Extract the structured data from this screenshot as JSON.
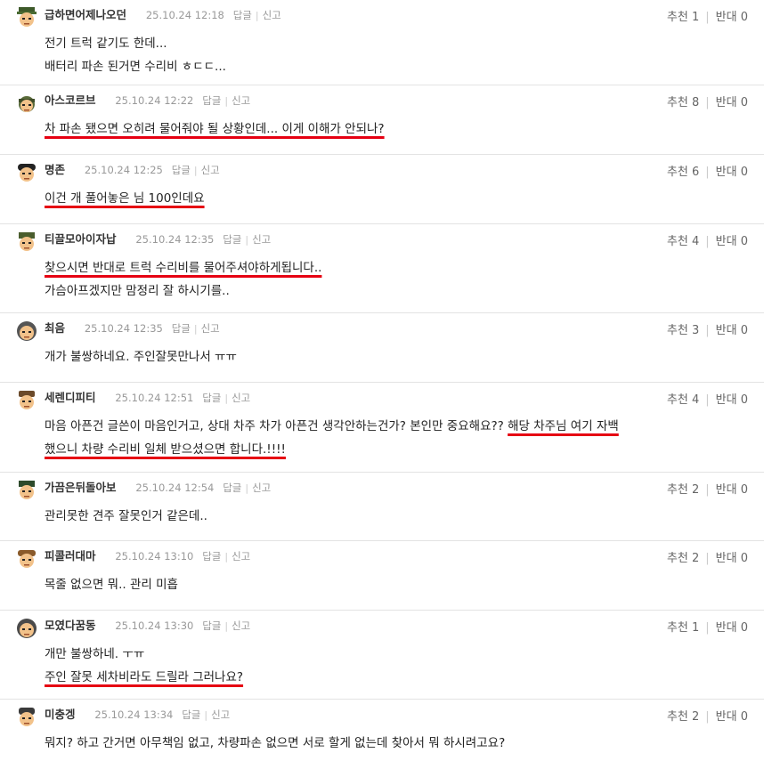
{
  "labels": {
    "reply": "답글",
    "report": "신고"
  },
  "comments": [
    {
      "nick": "급하면어제나오던",
      "date": "25.10.24 12:18",
      "up": "추천 1",
      "down": "반대 0",
      "line1": "전기 트럭 같기도 한데...",
      "line2": "배터리 파손 된거면 수리비 ㅎㄷㄷ..."
    },
    {
      "nick": "아스코르브",
      "date": "25.10.24 12:22",
      "up": "추천 8",
      "down": "반대 0",
      "line1": "차 파손 됐으면 오히려 물어줘야 될 상황인데... 이게 이해가 안되나?"
    },
    {
      "nick": "명존",
      "date": "25.10.24 12:25",
      "up": "추천 6",
      "down": "반대 0",
      "line1": "이건 개 풀어놓은 님 100인데요"
    },
    {
      "nick": "티끌모아이자납",
      "date": "25.10.24 12:35",
      "up": "추천 4",
      "down": "반대 0",
      "line1": "찾으시면 반대로 트럭 수리비를 물어주셔야하게됩니다..",
      "line2": "가슴아프겠지만 맘정리 잘 하시기를.."
    },
    {
      "nick": "최음",
      "date": "25.10.24 12:35",
      "up": "추천 3",
      "down": "반대 0",
      "line1": "개가 불쌍하네요. 주인잘못만나서 ㅠㅠ"
    },
    {
      "nick": "세렌디피티",
      "date": "25.10.24 12:51",
      "up": "추천 4",
      "down": "반대 0",
      "line1a": "마음 아픈건 글쓴이 마음인거고, 상대 차주 차가 아픈건 생각안하는건가? 본인만 중요해요?? ",
      "line1b": "해당 차주님 여기 자백",
      "line2": "했으니 차량 수리비 일체 받으셨으면 합니다.!!!!"
    },
    {
      "nick": "가끔은뒤돌아보",
      "date": "25.10.24 12:54",
      "up": "추천 2",
      "down": "반대 0",
      "line1": "관리못한 견주 잘못인거 같은데.."
    },
    {
      "nick": "피콜러대마",
      "date": "25.10.24 13:10",
      "up": "추천 2",
      "down": "반대 0",
      "line1": "목줄 없으면 뭐.. 관리 미흡"
    },
    {
      "nick": "모였다꿈동",
      "date": "25.10.24 13:30",
      "up": "추천 1",
      "down": "반대 0",
      "line1": "개만 불쌍하네. ㅜㅠ",
      "line2": "주인 잘못 세차비라도 드릴라 그러나요?"
    },
    {
      "nick": "미충겡",
      "date": "25.10.24 13:34",
      "up": "추천 2",
      "down": "반대 0",
      "line1": "뭐지? 하고 간거면 아무책임 없고, 차량파손 없으면 서로 할게 없는데 찾아서 뭐 하시려고요?"
    }
  ]
}
